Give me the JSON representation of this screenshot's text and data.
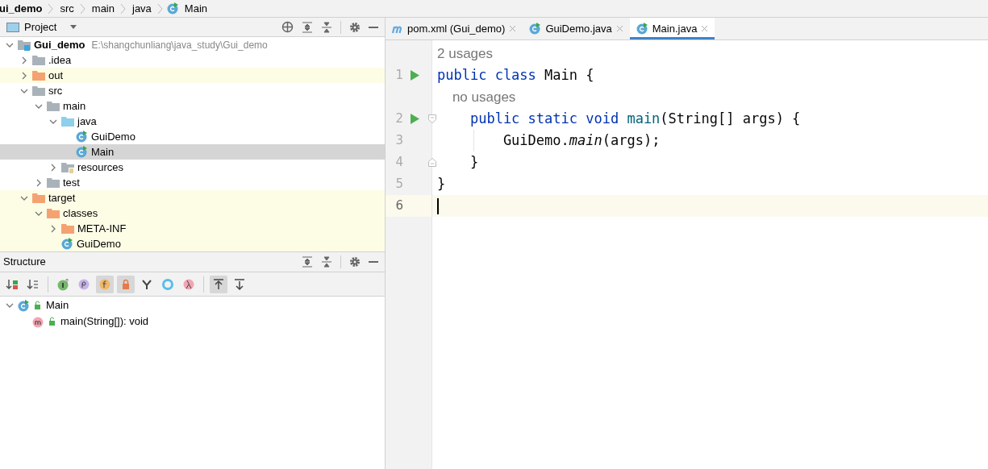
{
  "breadcrumbs": [
    {
      "label": "ui_demo",
      "kind": "module"
    },
    {
      "label": "src",
      "kind": "folder"
    },
    {
      "label": "main",
      "kind": "folder"
    },
    {
      "label": "java",
      "kind": "folder"
    },
    {
      "label": "Main",
      "kind": "class"
    }
  ],
  "project_panel": {
    "title": "Project",
    "tree": [
      {
        "label": "Gui_demo",
        "path": "E:\\shangchunliang\\java_study\\Gui_demo",
        "kind": "module",
        "expanded": true,
        "selected": false,
        "excluded": false,
        "children": [
          {
            "label": ".idea",
            "kind": "folder",
            "expanded": false,
            "selected": false,
            "excluded": false
          },
          {
            "label": "out",
            "kind": "folder_orange",
            "expanded": false,
            "selected": false,
            "excluded": true
          },
          {
            "label": "src",
            "kind": "folder",
            "expanded": true,
            "selected": false,
            "excluded": false,
            "children": [
              {
                "label": "main",
                "kind": "folder",
                "expanded": true,
                "selected": false,
                "excluded": false,
                "children": [
                  {
                    "label": "java",
                    "kind": "folder_blue",
                    "expanded": true,
                    "selected": false,
                    "excluded": false,
                    "children": [
                      {
                        "label": "GuiDemo",
                        "kind": "class",
                        "selected": false,
                        "excluded": false
                      },
                      {
                        "label": "Main",
                        "kind": "class",
                        "selected": true,
                        "excluded": false
                      }
                    ]
                  },
                  {
                    "label": "resources",
                    "kind": "resources",
                    "expanded": false,
                    "selected": false,
                    "excluded": false
                  }
                ]
              },
              {
                "label": "test",
                "kind": "folder",
                "expanded": false,
                "selected": false,
                "excluded": false
              }
            ]
          },
          {
            "label": "target",
            "kind": "folder_orange",
            "expanded": true,
            "selected": false,
            "excluded": true,
            "children": [
              {
                "label": "classes",
                "kind": "folder_orange",
                "expanded": true,
                "selected": false,
                "excluded": true,
                "children": [
                  {
                    "label": "META-INF",
                    "kind": "folder_orange",
                    "expanded": false,
                    "selected": false,
                    "excluded": true
                  },
                  {
                    "label": "GuiDemo",
                    "kind": "class",
                    "selected": false,
                    "excluded": true
                  }
                ]
              }
            ]
          }
        ]
      }
    ]
  },
  "structure_panel": {
    "title": "Structure",
    "toolbar": [
      {
        "kind": "sort_visibility",
        "selected": false
      },
      {
        "kind": "sort_alpha",
        "selected": false
      },
      {
        "kind": "sep"
      },
      {
        "kind": "inherited",
        "selected": false
      },
      {
        "kind": "properties",
        "selected": false
      },
      {
        "kind": "fields",
        "selected": true
      },
      {
        "kind": "non_public",
        "selected": true
      },
      {
        "kind": "lambda_tree",
        "selected": false
      },
      {
        "kind": "anonymous",
        "selected": false
      },
      {
        "kind": "lambdas",
        "selected": false
      },
      {
        "kind": "sep"
      },
      {
        "kind": "autoscroll_to",
        "selected": true
      },
      {
        "kind": "autoscroll_from",
        "selected": false
      }
    ],
    "tree": [
      {
        "label": "Main",
        "kind": "class",
        "expanded": true,
        "children": [
          {
            "label": "main(String[]): void",
            "kind": "method"
          }
        ]
      }
    ]
  },
  "tabs": [
    {
      "label": "pom.xml (Gui_demo)",
      "kind": "maven",
      "selected": false
    },
    {
      "label": "GuiDemo.java",
      "kind": "class",
      "selected": false
    },
    {
      "label": "Main.java",
      "kind": "class",
      "selected": true
    }
  ],
  "editor": {
    "lines": [
      {
        "kind": "hint",
        "text": "2 usages"
      },
      {
        "kind": "code",
        "number": "1",
        "run": true,
        "fold_start": false,
        "fold_end": false,
        "indent_guide": false,
        "current": false,
        "tokens": [
          {
            "kind": "keyword",
            "text": "public class "
          },
          {
            "kind": "plain",
            "text": "Main {"
          }
        ]
      },
      {
        "kind": "hint",
        "text": "    no usages"
      },
      {
        "kind": "code",
        "number": "2",
        "run": true,
        "fold_start": true,
        "fold_end": false,
        "indent_guide": false,
        "current": false,
        "tokens": [
          {
            "kind": "keyword",
            "text": "    public static void "
          },
          {
            "kind": "decl",
            "text": "main"
          },
          {
            "kind": "plain",
            "text": "(String[] args) {"
          }
        ]
      },
      {
        "kind": "code",
        "number": "3",
        "run": false,
        "fold_start": false,
        "fold_end": false,
        "indent_guide": true,
        "current": false,
        "tokens": [
          {
            "kind": "plain",
            "text": "        GuiDemo."
          },
          {
            "kind": "static_call",
            "text": "main"
          },
          {
            "kind": "plain",
            "text": "(args);"
          }
        ]
      },
      {
        "kind": "code",
        "number": "4",
        "run": false,
        "fold_start": false,
        "fold_end": true,
        "indent_guide": false,
        "current": false,
        "tokens": [
          {
            "kind": "plain",
            "text": "    }"
          }
        ]
      },
      {
        "kind": "code",
        "number": "5",
        "run": false,
        "fold_start": false,
        "fold_end": false,
        "indent_guide": false,
        "current": false,
        "tokens": [
          {
            "kind": "plain",
            "text": "}"
          }
        ]
      },
      {
        "kind": "code",
        "number": "6",
        "run": false,
        "fold_start": false,
        "fold_end": false,
        "indent_guide": false,
        "current": true
      }
    ]
  }
}
